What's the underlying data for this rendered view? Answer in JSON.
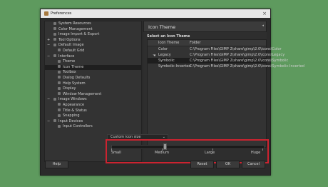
{
  "window": {
    "title": "Preferences",
    "close_glyph": "×"
  },
  "sidebar": {
    "items": [
      {
        "label": "System Resources",
        "expander": ""
      },
      {
        "label": "Color Management",
        "expander": ""
      },
      {
        "label": "Image Import & Export",
        "expander": ""
      },
      {
        "label": "Tool Options",
        "expander": "+"
      },
      {
        "label": "Default Image",
        "expander": "−"
      },
      {
        "label": "Default Grid",
        "expander": ""
      },
      {
        "label": "Interface",
        "expander": "−"
      },
      {
        "label": "Theme",
        "expander": ""
      },
      {
        "label": "Icon Theme",
        "expander": "",
        "selected": true
      },
      {
        "label": "Toolbox",
        "expander": ""
      },
      {
        "label": "Dialog Defaults",
        "expander": ""
      },
      {
        "label": "Help System",
        "expander": ""
      },
      {
        "label": "Display",
        "expander": ""
      },
      {
        "label": "Window Management",
        "expander": ""
      },
      {
        "label": "Image Windows",
        "expander": "−"
      },
      {
        "label": "Appearance",
        "expander": ""
      },
      {
        "label": "Title & Status",
        "expander": ""
      },
      {
        "label": "Snapping",
        "expander": ""
      },
      {
        "label": "Input Devices",
        "expander": "−"
      },
      {
        "label": "Input Controllers",
        "expander": ""
      }
    ]
  },
  "panel": {
    "title": "Icon Theme",
    "section_label": "Select an Icon Theme",
    "table": {
      "headers": [
        "Icon Theme",
        "Folder"
      ],
      "rows": [
        {
          "theme": "Color",
          "folder": "C:\\Program Files\\GIMP 2\\share\\gimp\\2.0\\icons\\Color",
          "icon": ""
        },
        {
          "theme": "Legacy",
          "folder": "C:\\Program Files\\GIMP 2\\share\\gimp\\2.0\\icons\\Legacy",
          "icon": "☚"
        },
        {
          "theme": "Symbolic",
          "folder": "C:\\Program Files\\GIMP 2\\share\\gimp\\2.0\\icons\\Symbolic",
          "icon": "",
          "selected": true
        },
        {
          "theme": "Symbolic-Inverted",
          "folder": "C:\\Program Files\\GIMP 2\\share\\gimp\\2.0\\icons\\Symbolic-Inverted",
          "icon": ""
        }
      ]
    },
    "icon_size": {
      "selected": "Custom icon size",
      "slider_labels": [
        "Small",
        "Medium",
        "Large",
        "Huge"
      ],
      "slider_position": 0.35
    }
  },
  "buttons": {
    "help": "Help",
    "reset": "Reset",
    "ok": "OK",
    "cancel": "Cancel"
  },
  "colors": {
    "background": "#5e9a5e",
    "highlight_box": "#cc2330"
  }
}
